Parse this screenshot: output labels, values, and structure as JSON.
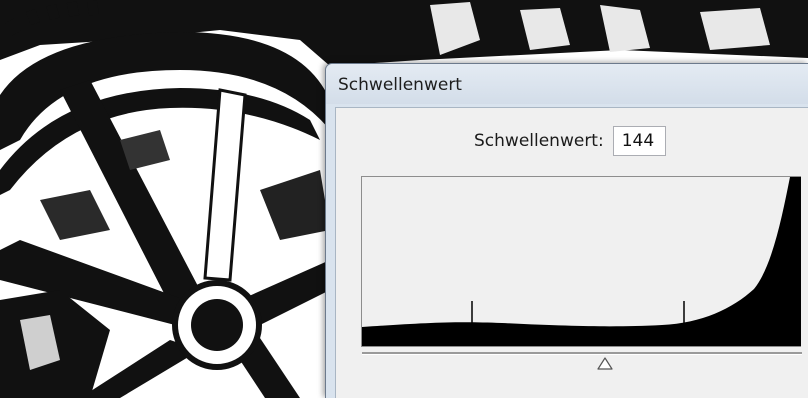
{
  "dialog": {
    "title": "Schwellenwert",
    "threshold_label": "Schwellenwert:",
    "threshold_value": "144"
  },
  "histogram": {
    "threshold_level": 144
  }
}
